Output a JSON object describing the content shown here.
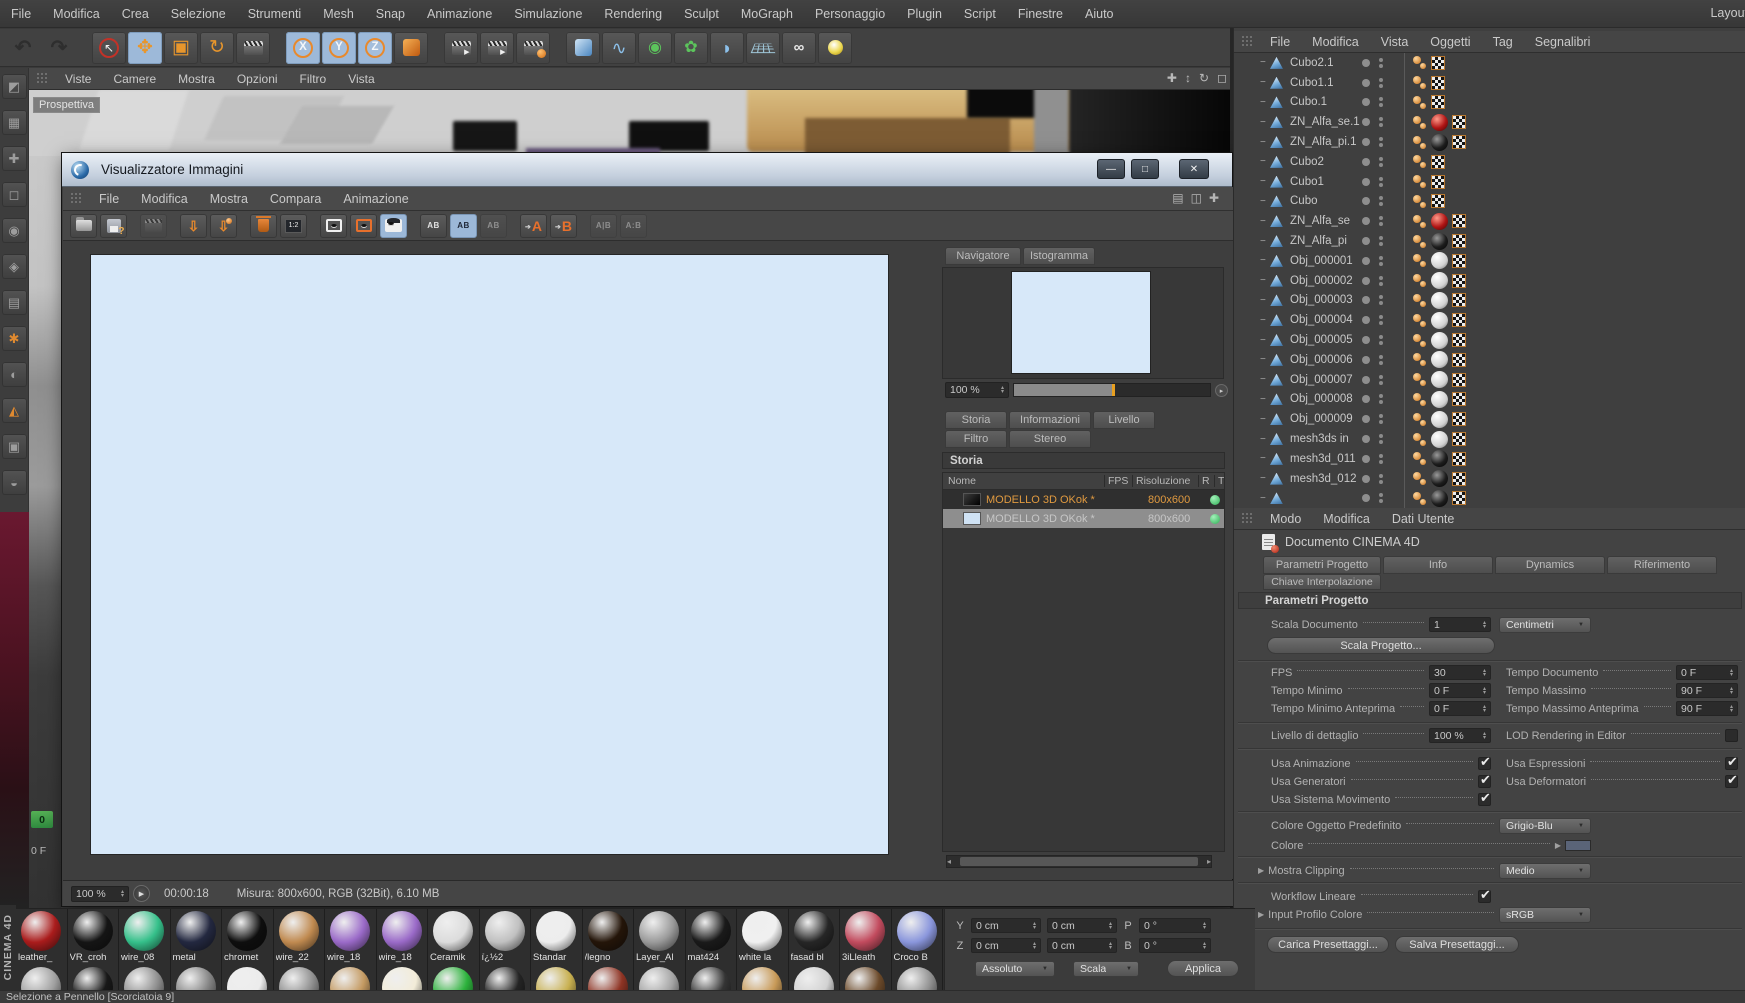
{
  "menubar": {
    "items": [
      "File",
      "Modifica",
      "Crea",
      "Selezione",
      "Strumenti",
      "Mesh",
      "Snap",
      "Animazione",
      "Simulazione",
      "Rendering",
      "Sculpt",
      "MoGraph",
      "Personaggio",
      "Plugin",
      "Script",
      "Finestre",
      "Aiuto"
    ],
    "right_label": "Layout"
  },
  "toolbar": {
    "icons": [
      {
        "name": "undo-icon",
        "glyph": "↶",
        "cls": "tb-dim"
      },
      {
        "name": "redo-icon",
        "glyph": "↷",
        "cls": "tb-dim"
      },
      {
        "name": "live-selection-icon",
        "glyph": "↖",
        "cls": "tb-sel tb-gap"
      },
      {
        "name": "move-tool-icon",
        "glyph": "✥",
        "cls": "tb-orange tb-active"
      },
      {
        "name": "scale-tool-icon",
        "glyph": "▣",
        "cls": "tb-orange"
      },
      {
        "name": "rotate-tool-icon",
        "glyph": "↻",
        "cls": "tb-orange"
      },
      {
        "name": "keyframe-clapper-icon",
        "glyph": "",
        "cls": "tb-clap"
      },
      {
        "name": "lock-x-axis-icon",
        "glyph": "X",
        "cls": "tb-axis tb-active tb-gap"
      },
      {
        "name": "lock-y-axis-icon",
        "glyph": "Y",
        "cls": "tb-axis tb-active"
      },
      {
        "name": "lock-z-axis-icon",
        "glyph": "Z",
        "cls": "tb-axis tb-active"
      },
      {
        "name": "coordinate-system-icon",
        "glyph": "",
        "cls": "tb-cube-orange"
      },
      {
        "name": "render-view-icon",
        "glyph": "",
        "cls": "tb-clap tb-clap-play tb-gap"
      },
      {
        "name": "render-picture-viewer-icon",
        "glyph": "",
        "cls": "tb-clap tb-clap-play"
      },
      {
        "name": "render-settings-icon",
        "glyph": "",
        "cls": "tb-clap tb-clap-gear"
      },
      {
        "name": "cube-primitive-icon",
        "glyph": "",
        "cls": "tb-cube-blue tb-gap"
      },
      {
        "name": "spline-icon",
        "glyph": "∿",
        "cls": "tb-blue"
      },
      {
        "name": "subdivision-surface-icon",
        "glyph": "◉",
        "cls": "tb-green"
      },
      {
        "name": "mograph-icon",
        "glyph": "✿",
        "cls": "tb-green"
      },
      {
        "name": "field-icon",
        "glyph": "◗",
        "cls": "tb-blue"
      },
      {
        "name": "floor-icon",
        "glyph": "",
        "cls": "tb-grid"
      },
      {
        "name": "camera-icon",
        "glyph": "∞",
        "cls": "tb-white"
      },
      {
        "name": "light-icon",
        "glyph": "",
        "cls": "tb-bulb"
      }
    ]
  },
  "left_palette": {
    "icons": [
      {
        "name": "selection-tool-icon",
        "glyph": "◩",
        "cls": ""
      },
      {
        "name": "grid-tool-icon",
        "glyph": "▦",
        "cls": ""
      },
      {
        "name": "pan-tool-icon",
        "glyph": "✚",
        "cls": ""
      },
      {
        "name": "frame-tool-icon",
        "glyph": "◻",
        "cls": ""
      },
      {
        "name": "sphere-tool-icon",
        "glyph": "◉",
        "cls": ""
      },
      {
        "name": "diamond-tool-icon",
        "glyph": "◈",
        "cls": ""
      },
      {
        "name": "layers-tool-icon",
        "glyph": "▤",
        "cls": ""
      },
      {
        "name": "wrench-tool-icon",
        "glyph": "✱",
        "cls": "lp-or"
      },
      {
        "name": "shade-tool-icon",
        "glyph": "◐",
        "cls": ""
      },
      {
        "name": "cone-tool-icon",
        "glyph": "◭",
        "cls": "lp-or"
      },
      {
        "name": "panel-tool-icon",
        "glyph": "▣",
        "cls": ""
      },
      {
        "name": "half-tool-icon",
        "glyph": "◒",
        "cls": ""
      }
    ]
  },
  "viewport": {
    "menu": [
      "Viste",
      "Camere",
      "Mostra",
      "Opzioni",
      "Filtro",
      "Vista"
    ],
    "right_icons": [
      {
        "name": "pan-view-icon",
        "glyph": "✚"
      },
      {
        "name": "zoom-view-icon",
        "glyph": "↕"
      },
      {
        "name": "rotate-view-icon",
        "glyph": "↻"
      },
      {
        "name": "toggle-view-icon",
        "glyph": "◻"
      }
    ],
    "view_label": "Prospettiva",
    "frame_badge": "0",
    "frame_label": "0 F"
  },
  "picture_viewer": {
    "title": "Visualizzatore Immagini",
    "window_buttons": [
      {
        "name": "minimize-button",
        "glyph": "—"
      },
      {
        "name": "maximize-button",
        "glyph": "□"
      },
      {
        "name": "close-button",
        "glyph": "✕"
      }
    ],
    "menu": [
      "File",
      "Modifica",
      "Mostra",
      "Compara",
      "Animazione"
    ],
    "panel_icons": [
      {
        "name": "dock-layout-icon",
        "glyph": "▤"
      },
      {
        "name": "split-layout-icon",
        "glyph": "◫"
      },
      {
        "name": "expand-layout-icon",
        "glyph": "✚"
      }
    ],
    "toolbar_icons": [
      {
        "name": "open-image-icon",
        "glyph": "",
        "cls": "pv-folder"
      },
      {
        "name": "save-image-icon",
        "glyph": "",
        "cls": "pv-disk"
      },
      {
        "name": "render-clapper-icon",
        "glyph": "",
        "cls": "pv-clap pv-dim pv-gapl"
      },
      {
        "name": "load-render-icon",
        "glyph": "⇩",
        "cls": "pv-or pv-gapl"
      },
      {
        "name": "load-user-render-icon",
        "glyph": "⇩",
        "cls": "pv-or pv-person"
      },
      {
        "name": "delete-image-icon",
        "glyph": "",
        "cls": "pv-trash pv-gapl"
      },
      {
        "name": "dual-image-icon",
        "glyph": "1:2",
        "cls": "pv-film"
      },
      {
        "name": "show-image-a-icon",
        "glyph": "",
        "cls": "pv-eyeA pv-gapl"
      },
      {
        "name": "show-image-b-icon",
        "glyph": "",
        "cls": "pv-eyeB"
      },
      {
        "name": "show-image-ab-icon",
        "glyph": "",
        "cls": "pv-eyeHat pv-active"
      },
      {
        "name": "compare-vertical-icon",
        "glyph": "AB",
        "cls": "pv-ab pv-gapl"
      },
      {
        "name": "compare-horizontal-icon",
        "glyph": "AB",
        "cls": "pv-ab pv-active"
      },
      {
        "name": "compare-overlay-icon",
        "glyph": "AB",
        "cls": "pv-ab pv-dim"
      },
      {
        "name": "set-image-a-icon",
        "glyph": "A",
        "cls": "pv-letter pv-gapl"
      },
      {
        "name": "set-image-b-icon",
        "glyph": "B",
        "cls": "pv-letter"
      },
      {
        "name": "swap-ab-icon",
        "glyph": "A|B",
        "cls": "pv-ab pv-dim pv-gapl"
      },
      {
        "name": "link-ab-icon",
        "glyph": "A:B",
        "cls": "pv-ab pv-dim"
      }
    ],
    "navigator": {
      "tabs": [
        {
          "label": "Navigatore",
          "cls": "active"
        },
        {
          "label": "Istogramma",
          "cls": ""
        }
      ],
      "zoom": "100 %"
    },
    "history": {
      "tabs_row1": [
        {
          "label": "Storia",
          "cls": "active"
        },
        {
          "label": "Informazioni",
          "cls": ""
        },
        {
          "label": "Livello",
          "cls": ""
        }
      ],
      "tabs_row2": [
        {
          "label": "Filtro",
          "cls": ""
        },
        {
          "label": "Stereo",
          "cls": ""
        }
      ],
      "section": "Storia",
      "columns": [
        "Nome",
        "FPS",
        "Risoluzione",
        "R",
        "T"
      ],
      "rows": [
        {
          "name": "MODELLO 3D OKok *",
          "fps": "",
          "resolution": "800x600",
          "cls": "hr-current"
        },
        {
          "name": "MODELLO 3D OKok *",
          "fps": "",
          "resolution": "800x600",
          "cls": "hr-previous"
        }
      ]
    },
    "statusbar": {
      "zoom": "100 %",
      "time": "00:00:18",
      "info": "Misura: 800x600, RGB (32Bit), 6.10 MB"
    }
  },
  "object_manager": {
    "menu": [
      "File",
      "Modifica",
      "Vista",
      "Oggetti",
      "Tag",
      "Segnalibri"
    ],
    "objects": [
      {
        "name": "Cubo2.1",
        "sphere_class": "s-none"
      },
      {
        "name": "Cubo1.1",
        "sphere_class": "s-none"
      },
      {
        "name": "Cubo.1",
        "sphere_class": "s-none"
      },
      {
        "name": "ZN_Alfa_se.1",
        "sphere_class": "s-red"
      },
      {
        "name": "ZN_Alfa_pi.1",
        "sphere_class": "s-black"
      },
      {
        "name": "Cubo2",
        "sphere_class": "s-none"
      },
      {
        "name": "Cubo1",
        "sphere_class": "s-none"
      },
      {
        "name": "Cubo",
        "sphere_class": "s-none"
      },
      {
        "name": "ZN_Alfa_se",
        "sphere_class": "s-red"
      },
      {
        "name": "ZN_Alfa_pi",
        "sphere_class": "s-black"
      },
      {
        "name": "Obj_000001",
        "sphere_class": "s-white"
      },
      {
        "name": "Obj_000002",
        "sphere_class": "s-white"
      },
      {
        "name": "Obj_000003",
        "sphere_class": "s-white"
      },
      {
        "name": "Obj_000004",
        "sphere_class": "s-white"
      },
      {
        "name": "Obj_000005",
        "sphere_class": "s-white"
      },
      {
        "name": "Obj_000006",
        "sphere_class": "s-white"
      },
      {
        "name": "Obj_000007",
        "sphere_class": "s-white"
      },
      {
        "name": "Obj_000008",
        "sphere_class": "s-white"
      },
      {
        "name": "Obj_000009",
        "sphere_class": "s-white"
      },
      {
        "name": "mesh3ds in",
        "sphere_class": "s-white"
      },
      {
        "name": "mesh3d_011",
        "sphere_class": "s-black"
      },
      {
        "name": "mesh3d_012",
        "sphere_class": "s-black"
      },
      {
        "name": "",
        "sphere_class": "s-black"
      }
    ]
  },
  "attribute_manager": {
    "menu": [
      "Modo",
      "Modifica",
      "Dati Utente"
    ],
    "document_title": "Documento CINEMA 4D",
    "tabs": [
      {
        "label": "Parametri Progetto",
        "cls": "active"
      },
      {
        "label": "Info",
        "cls": ""
      },
      {
        "label": "Dynamics",
        "cls": ""
      },
      {
        "label": "Riferimento",
        "cls": ""
      }
    ],
    "tab2": "Chiave Interpolazione",
    "section": "Parametri Progetto",
    "scala_documento": {
      "label": "Scala Documento",
      "value": "1",
      "unit": "Centimetri"
    },
    "scala_progetto": "Scala Progetto...",
    "fps": {
      "label": "FPS",
      "value": "30"
    },
    "tempo_documento": {
      "label": "Tempo Documento",
      "value": "0 F"
    },
    "tempo_minimo": {
      "label": "Tempo Minimo",
      "value": "0 F"
    },
    "tempo_massimo": {
      "label": "Tempo Massimo",
      "value": "90 F"
    },
    "tempo_minimo_anteprima": {
      "label": "Tempo Minimo Anteprima",
      "value": "0 F"
    },
    "tempo_massimo_anteprima": {
      "label": "Tempo Massimo Anteprima",
      "value": "90 F"
    },
    "livello_dettaglio": {
      "label": "Livello di dettaglio",
      "value": "100 %"
    },
    "lod_rendering": {
      "label": "LOD Rendering in Editor",
      "checked": false
    },
    "usa_animazione": {
      "label": "Usa Animazione",
      "checked": true
    },
    "usa_espressioni": {
      "label": "Usa Espressioni",
      "checked": true
    },
    "usa_generatori": {
      "label": "Usa Generatori",
      "checked": true
    },
    "usa_deformatori": {
      "label": "Usa Deformatori",
      "checked": true
    },
    "usa_sistema_movimento": {
      "label": "Usa Sistema Movimento",
      "checked": true
    },
    "colore_oggetto": {
      "label": "Colore Oggetto Predefinito",
      "value": "Grigio-Blu"
    },
    "colore": {
      "label": "Colore",
      "swatch": "#5a6478"
    },
    "mostra_clipping": {
      "label": "Mostra Clipping",
      "value": "Medio"
    },
    "workflow_lineare": {
      "label": "Workflow Lineare",
      "checked": true
    },
    "input_profilo_colore": {
      "label": "Input Profilo Colore",
      "value": "sRGB"
    },
    "load_preset": "Carica Presettaggi...",
    "save_preset": "Salva Presettaggi..."
  },
  "materials": {
    "row1": [
      {
        "name": "leather_",
        "color": "#aa1c1c"
      },
      {
        "name": "VR_croh",
        "color": "#151515"
      },
      {
        "name": "wire_08",
        "color": "#35c08a"
      },
      {
        "name": "metal",
        "color": "#232840"
      },
      {
        "name": "chromet",
        "color": "#0e0e0e"
      },
      {
        "name": "wire_22",
        "color": "#c08a50"
      },
      {
        "name": "wire_18",
        "color": "#9a6ac8"
      },
      {
        "name": "wire_18",
        "color": "#9a6ac8"
      },
      {
        "name": "Ceramik",
        "color": "#dcdcdc"
      },
      {
        "name": "ï¿½2",
        "color": "#c0c0c0"
      },
      {
        "name": "Standar",
        "color": "#ededed"
      },
      {
        "name": "/legno",
        "color": "#241509"
      },
      {
        "name": "Layer_Al",
        "color": "#9a9a9a"
      },
      {
        "name": "mat424",
        "color": "#1a1a1a"
      },
      {
        "name": "white la",
        "color": "#f0f0f0"
      },
      {
        "name": "fasad bl",
        "color": "#262626"
      },
      {
        "name": "3iLleath",
        "color": "#c24b5e"
      },
      {
        "name": "Croco B",
        "color": "#8a96dc"
      }
    ],
    "row2_colors": [
      "#a0a0a0",
      "#181818",
      "#8e8e8e",
      "#828282",
      "#ececec",
      "#8e8e8e",
      "#c49a62",
      "#f2ecd8",
      "#2cb23c",
      "#242424",
      "#c8b050",
      "#8e3424",
      "#a4a4a4",
      "#343434",
      "#c89a58",
      "#d2d2d2",
      "#6c4a2a",
      "#909090"
    ]
  },
  "coordinates": {
    "rows": [
      {
        "axis": "Y",
        "pos": "0 cm",
        "scale": "0 cm",
        "rot_axis": "P",
        "rot": "0 °"
      },
      {
        "axis": "Z",
        "pos": "0 cm",
        "scale": "0 cm",
        "rot_axis": "B",
        "rot": "0 °"
      }
    ],
    "mode_primary": "Assoluto",
    "mode_secondary": "Scala",
    "apply_label": "Applica"
  },
  "status_text": "Selezione a Pennello [Scorciatoia 9]",
  "brand": "CINEMA 4D",
  "colors": {
    "accent_orange": "#e8892c",
    "history_highlight": "#e09a40",
    "tab_active": "#a3bedd",
    "status_green": "#4ad478",
    "canvas_blue": "#d7e8f9"
  }
}
